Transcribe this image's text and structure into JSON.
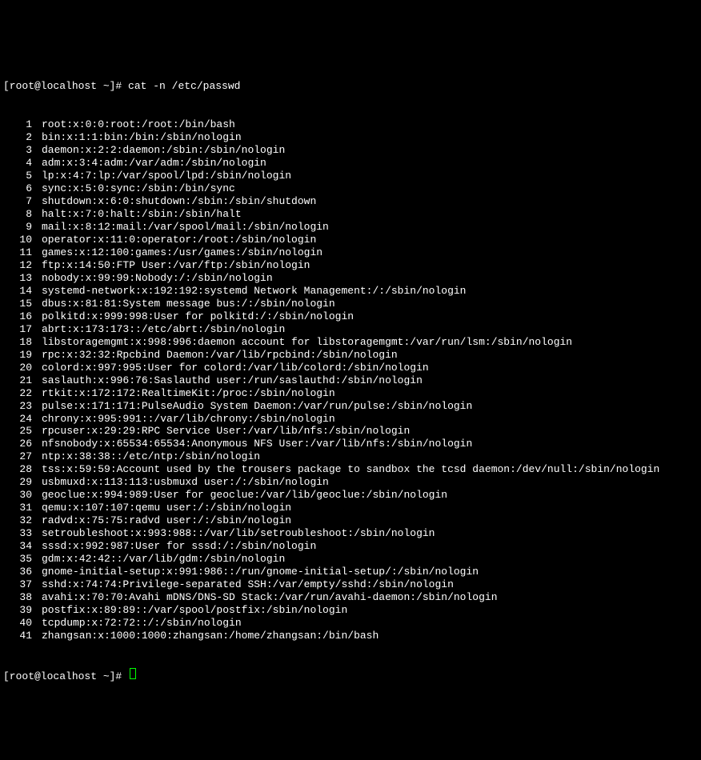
{
  "terminal": {
    "prompt1": "[root@localhost ~]# ",
    "command": "cat -n /etc/passwd",
    "prompt2": "[root@localhost ~]# ",
    "lines": [
      {
        "num": "1",
        "content": "root:x:0:0:root:/root:/bin/bash"
      },
      {
        "num": "2",
        "content": "bin:x:1:1:bin:/bin:/sbin/nologin"
      },
      {
        "num": "3",
        "content": "daemon:x:2:2:daemon:/sbin:/sbin/nologin"
      },
      {
        "num": "4",
        "content": "adm:x:3:4:adm:/var/adm:/sbin/nologin"
      },
      {
        "num": "5",
        "content": "lp:x:4:7:lp:/var/spool/lpd:/sbin/nologin"
      },
      {
        "num": "6",
        "content": "sync:x:5:0:sync:/sbin:/bin/sync"
      },
      {
        "num": "7",
        "content": "shutdown:x:6:0:shutdown:/sbin:/sbin/shutdown"
      },
      {
        "num": "8",
        "content": "halt:x:7:0:halt:/sbin:/sbin/halt"
      },
      {
        "num": "9",
        "content": "mail:x:8:12:mail:/var/spool/mail:/sbin/nologin"
      },
      {
        "num": "10",
        "content": "operator:x:11:0:operator:/root:/sbin/nologin"
      },
      {
        "num": "11",
        "content": "games:x:12:100:games:/usr/games:/sbin/nologin"
      },
      {
        "num": "12",
        "content": "ftp:x:14:50:FTP User:/var/ftp:/sbin/nologin"
      },
      {
        "num": "13",
        "content": "nobody:x:99:99:Nobody:/:/sbin/nologin"
      },
      {
        "num": "14",
        "content": "systemd-network:x:192:192:systemd Network Management:/:/sbin/nologin"
      },
      {
        "num": "15",
        "content": "dbus:x:81:81:System message bus:/:/sbin/nologin"
      },
      {
        "num": "16",
        "content": "polkitd:x:999:998:User for polkitd:/:/sbin/nologin"
      },
      {
        "num": "17",
        "content": "abrt:x:173:173::/etc/abrt:/sbin/nologin"
      },
      {
        "num": "18",
        "content": "libstoragemgmt:x:998:996:daemon account for libstoragemgmt:/var/run/lsm:/sbin/nologin"
      },
      {
        "num": "19",
        "content": "rpc:x:32:32:Rpcbind Daemon:/var/lib/rpcbind:/sbin/nologin"
      },
      {
        "num": "20",
        "content": "colord:x:997:995:User for colord:/var/lib/colord:/sbin/nologin"
      },
      {
        "num": "21",
        "content": "saslauth:x:996:76:Saslauthd user:/run/saslauthd:/sbin/nologin"
      },
      {
        "num": "22",
        "content": "rtkit:x:172:172:RealtimeKit:/proc:/sbin/nologin"
      },
      {
        "num": "23",
        "content": "pulse:x:171:171:PulseAudio System Daemon:/var/run/pulse:/sbin/nologin"
      },
      {
        "num": "24",
        "content": "chrony:x:995:991::/var/lib/chrony:/sbin/nologin"
      },
      {
        "num": "25",
        "content": "rpcuser:x:29:29:RPC Service User:/var/lib/nfs:/sbin/nologin"
      },
      {
        "num": "26",
        "content": "nfsnobody:x:65534:65534:Anonymous NFS User:/var/lib/nfs:/sbin/nologin"
      },
      {
        "num": "27",
        "content": "ntp:x:38:38::/etc/ntp:/sbin/nologin"
      },
      {
        "num": "28",
        "content": "tss:x:59:59:Account used by the trousers package to sandbox the tcsd daemon:/dev/null:/sbin/nologin"
      },
      {
        "num": "29",
        "content": "usbmuxd:x:113:113:usbmuxd user:/:/sbin/nologin"
      },
      {
        "num": "30",
        "content": "geoclue:x:994:989:User for geoclue:/var/lib/geoclue:/sbin/nologin"
      },
      {
        "num": "31",
        "content": "qemu:x:107:107:qemu user:/:/sbin/nologin"
      },
      {
        "num": "32",
        "content": "radvd:x:75:75:radvd user:/:/sbin/nologin"
      },
      {
        "num": "33",
        "content": "setroubleshoot:x:993:988::/var/lib/setroubleshoot:/sbin/nologin"
      },
      {
        "num": "34",
        "content": "sssd:x:992:987:User for sssd:/:/sbin/nologin"
      },
      {
        "num": "35",
        "content": "gdm:x:42:42::/var/lib/gdm:/sbin/nologin"
      },
      {
        "num": "36",
        "content": "gnome-initial-setup:x:991:986::/run/gnome-initial-setup/:/sbin/nologin"
      },
      {
        "num": "37",
        "content": "sshd:x:74:74:Privilege-separated SSH:/var/empty/sshd:/sbin/nologin"
      },
      {
        "num": "38",
        "content": "avahi:x:70:70:Avahi mDNS/DNS-SD Stack:/var/run/avahi-daemon:/sbin/nologin"
      },
      {
        "num": "39",
        "content": "postfix:x:89:89::/var/spool/postfix:/sbin/nologin"
      },
      {
        "num": "40",
        "content": "tcpdump:x:72:72::/:/sbin/nologin"
      },
      {
        "num": "41",
        "content": "zhangsan:x:1000:1000:zhangsan:/home/zhangsan:/bin/bash"
      }
    ]
  }
}
